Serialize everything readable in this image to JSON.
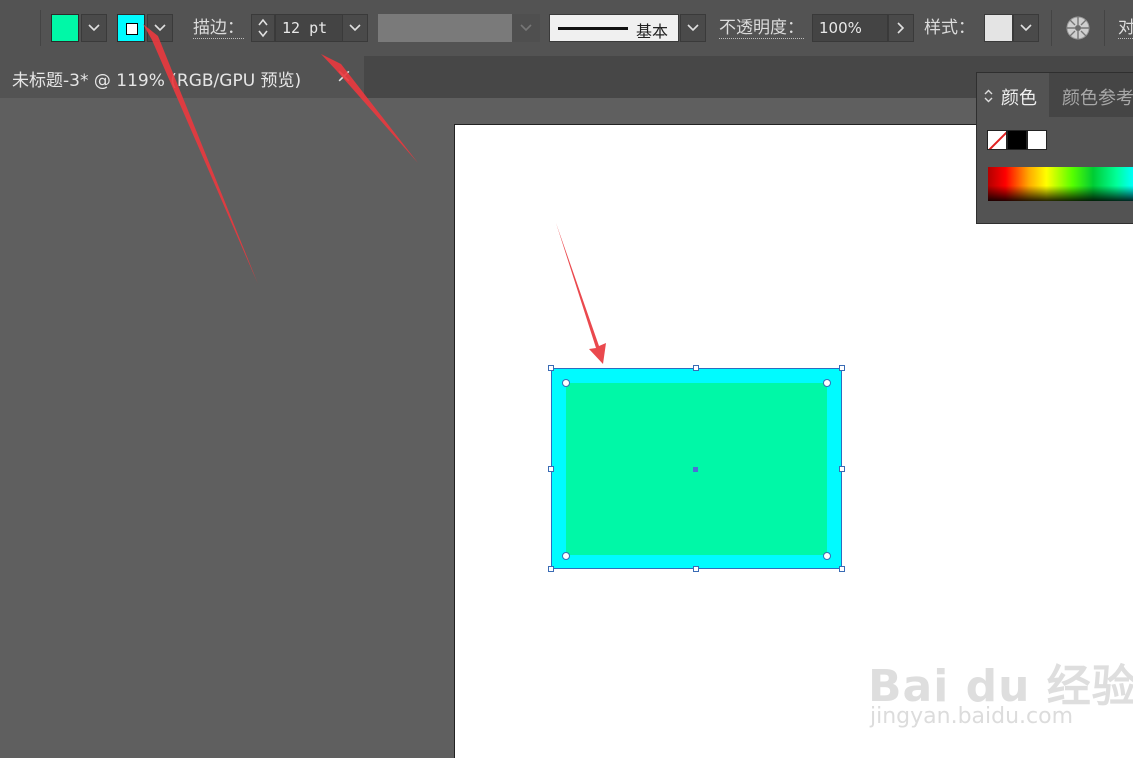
{
  "control_bar": {
    "fill_color": "#00f8a7",
    "stroke_color": "#00fbff",
    "stroke_label": "描边：",
    "stroke_weight": "12 pt",
    "stroke_profile": "基本",
    "opacity_label": "不透明度：",
    "opacity_value": "100%",
    "style_label": "样式：",
    "truncated_label": "对"
  },
  "document_tab": {
    "title": "未标题-3* @ 119% (RGB/GPU 预览)",
    "close_glyph": "×"
  },
  "canvas": {
    "shape_stroke_color": "#00fbff",
    "shape_fill_color": "#00f8a7"
  },
  "color_panel": {
    "tab_color": "颜色",
    "tab_color_guide": "颜色参考"
  },
  "watermark": {
    "logo": "Bai du 经验",
    "url": "jingyan.baidu.com"
  },
  "colors": {
    "annotation_arrow": "#e8393f",
    "selection_handle": "#3a6bb5"
  }
}
